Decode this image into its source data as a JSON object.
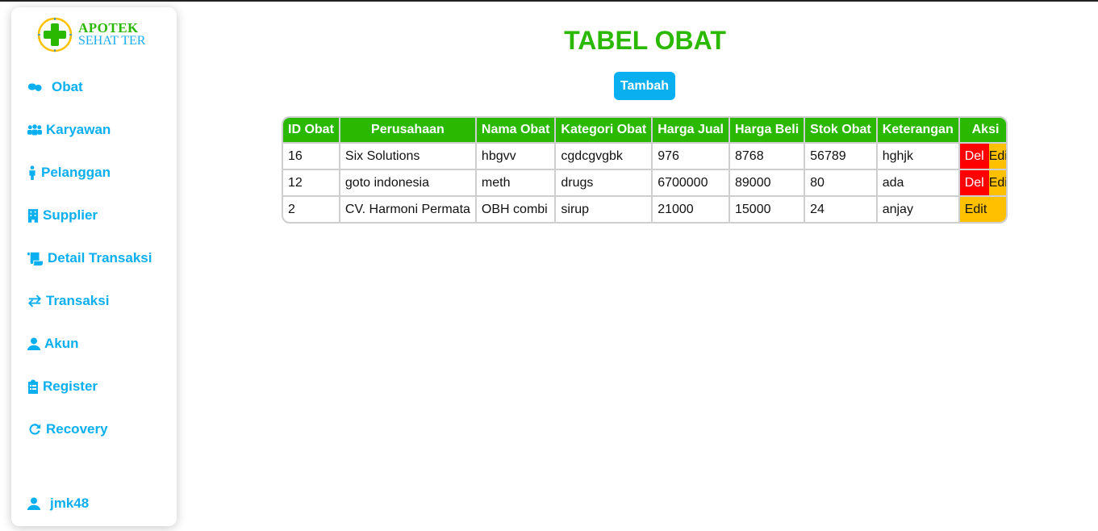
{
  "brand": {
    "line1": "APOTEK",
    "line2": "SEHAT TER",
    "colors": {
      "green": "#2bb800",
      "blue": "#0aaff0"
    }
  },
  "sidebar": {
    "items": [
      {
        "label": "Obat",
        "icon": "pills-icon"
      },
      {
        "label": "Karyawan",
        "icon": "users-icon"
      },
      {
        "label": "Pelanggan",
        "icon": "person-icon"
      },
      {
        "label": "Supplier",
        "icon": "building-icon"
      },
      {
        "label": "Detail Transaksi",
        "icon": "scroll-icon"
      },
      {
        "label": "Transaksi",
        "icon": "exchange-icon"
      },
      {
        "label": "Akun",
        "icon": "user-icon"
      },
      {
        "label": "Register",
        "icon": "clipboard-icon"
      },
      {
        "label": "Recovery",
        "icon": "refresh-icon"
      }
    ],
    "user": {
      "label": "jmk48",
      "icon": "user-icon"
    }
  },
  "main": {
    "title": "TABEL OBAT",
    "add_label": "Tambah",
    "table": {
      "headers": [
        "ID Obat",
        "Perusahaan",
        "Nama Obat",
        "Kategori Obat",
        "Harga Jual",
        "Harga Beli",
        "Stok Obat",
        "Keterangan",
        "Aksi"
      ],
      "rows": [
        {
          "cells": [
            "16",
            "Six Solutions",
            "hbgvv",
            "cgdcgvgbk",
            "976",
            "8768",
            "56789",
            "hghjk"
          ],
          "del": "Del",
          "edit": "Edit"
        },
        {
          "cells": [
            "12",
            "goto indonesia",
            "meth",
            "drugs",
            "6700000",
            "89000",
            "80",
            "ada"
          ],
          "del": "Del",
          "edit": "Edit"
        },
        {
          "cells": [
            "2",
            "CV. Harmoni Permata",
            "OBH combi",
            "sirup",
            "21000",
            "15000",
            "24",
            "anjay"
          ],
          "del": null,
          "edit": "Edit"
        }
      ]
    }
  }
}
